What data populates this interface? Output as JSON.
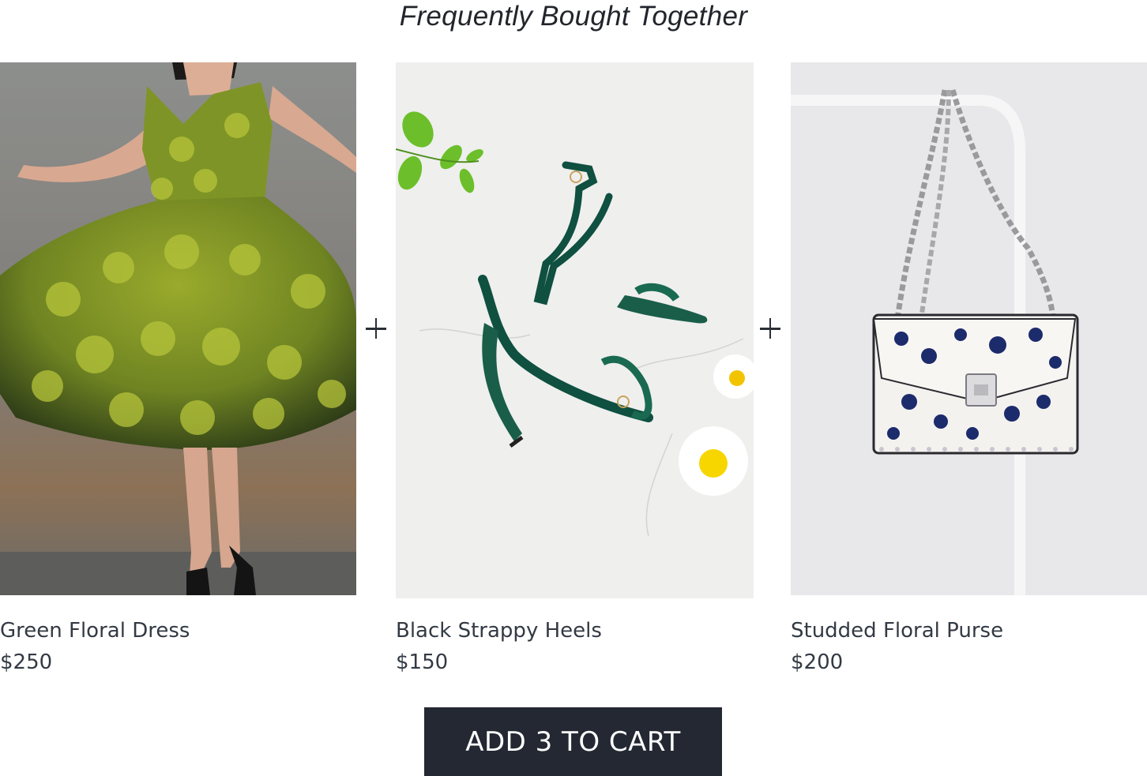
{
  "section": {
    "title": "Frequently Bought Together"
  },
  "products": [
    {
      "name": "Green Floral Dress",
      "price": "$250",
      "image": "green-floral-dress-photo"
    },
    {
      "name": "Black Strappy Heels",
      "price": "$150",
      "image": "strappy-heels-photo"
    },
    {
      "name": "Studded Floral Purse",
      "price": "$200",
      "image": "floral-purse-photo"
    }
  ],
  "separators": [
    "plus-icon",
    "plus-icon"
  ],
  "cart": {
    "button_label": "ADD 3 TO CART"
  },
  "colors": {
    "button_bg": "#232832",
    "button_text": "#ffffff",
    "text": "#333a44"
  }
}
